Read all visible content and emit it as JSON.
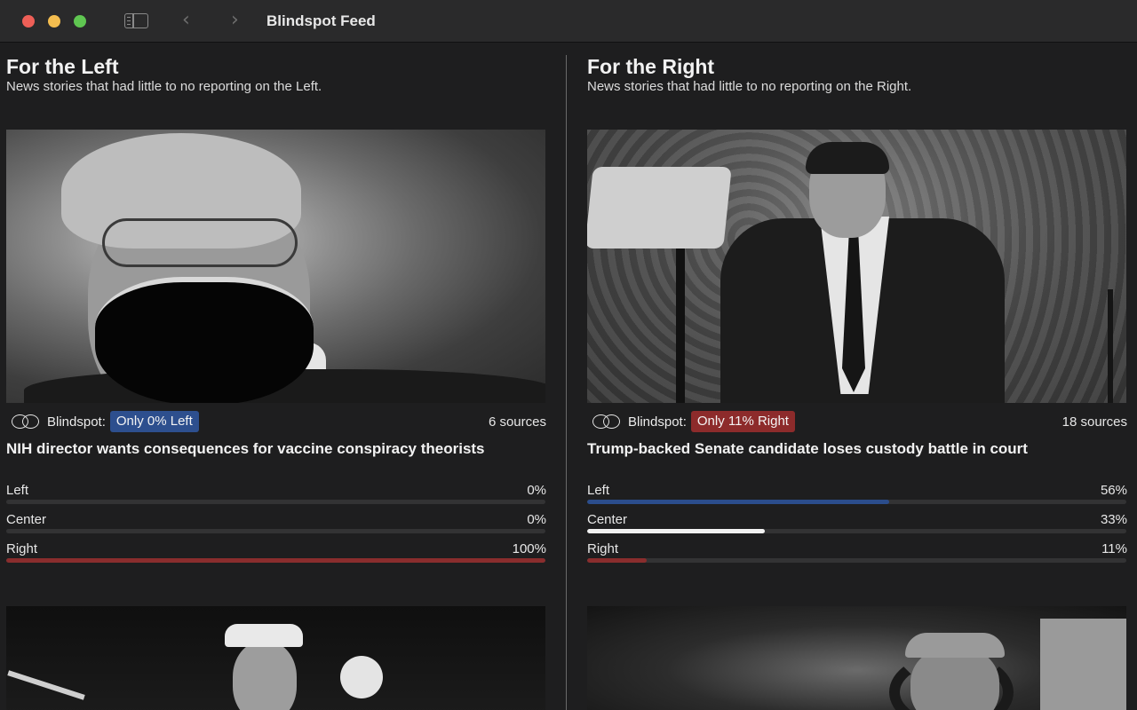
{
  "window": {
    "title": "Blindspot Feed"
  },
  "left_column": {
    "heading": "For the Left",
    "subheading": "News stories that had little to no reporting on the Left.",
    "card": {
      "blindspot_label": "Blindspot:",
      "badge": "Only 0% Left",
      "sources": "6 sources",
      "headline": "NIH director wants consequences for vaccine conspiracy theorists",
      "coverage": [
        {
          "label": "Left",
          "value": "0%",
          "percent": 0
        },
        {
          "label": "Center",
          "value": "0%",
          "percent": 0
        },
        {
          "label": "Right",
          "value": "100%",
          "percent": 100
        }
      ]
    }
  },
  "right_column": {
    "heading": "For the Right",
    "subheading": "News stories that had little to no reporting on the Right.",
    "card": {
      "blindspot_label": "Blindspot:",
      "badge": "Only 11% Right",
      "sources": "18 sources",
      "headline": "Trump-backed Senate candidate loses custody battle in court",
      "coverage": [
        {
          "label": "Left",
          "value": "56%",
          "percent": 56
        },
        {
          "label": "Center",
          "value": "33%",
          "percent": 33
        },
        {
          "label": "Right",
          "value": "11%",
          "percent": 11
        }
      ]
    }
  },
  "icons": {
    "back": "chevron-left-icon",
    "forward": "chevron-right-icon",
    "sidebar": "sidebar-toggle-icon",
    "blindspot": "blindspot-logo-icon"
  },
  "colors": {
    "left": "#2b4d8c",
    "center": "#f2f2f2",
    "right": "#8a2d2d",
    "badge_left": "#2d4f8e",
    "badge_right": "#8d2b2b"
  }
}
